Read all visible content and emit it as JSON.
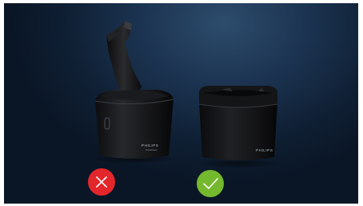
{
  "product_left": {
    "brand": "PHILIPS",
    "model": "SmartClean",
    "status": "incorrect"
  },
  "product_right": {
    "brand": "PHILIPS",
    "status": "correct"
  },
  "colors": {
    "background": "#14273f",
    "incorrect": "#e3262b",
    "correct": "#74b82e"
  },
  "icons": {
    "incorrect": "cross-icon",
    "correct": "check-icon"
  }
}
